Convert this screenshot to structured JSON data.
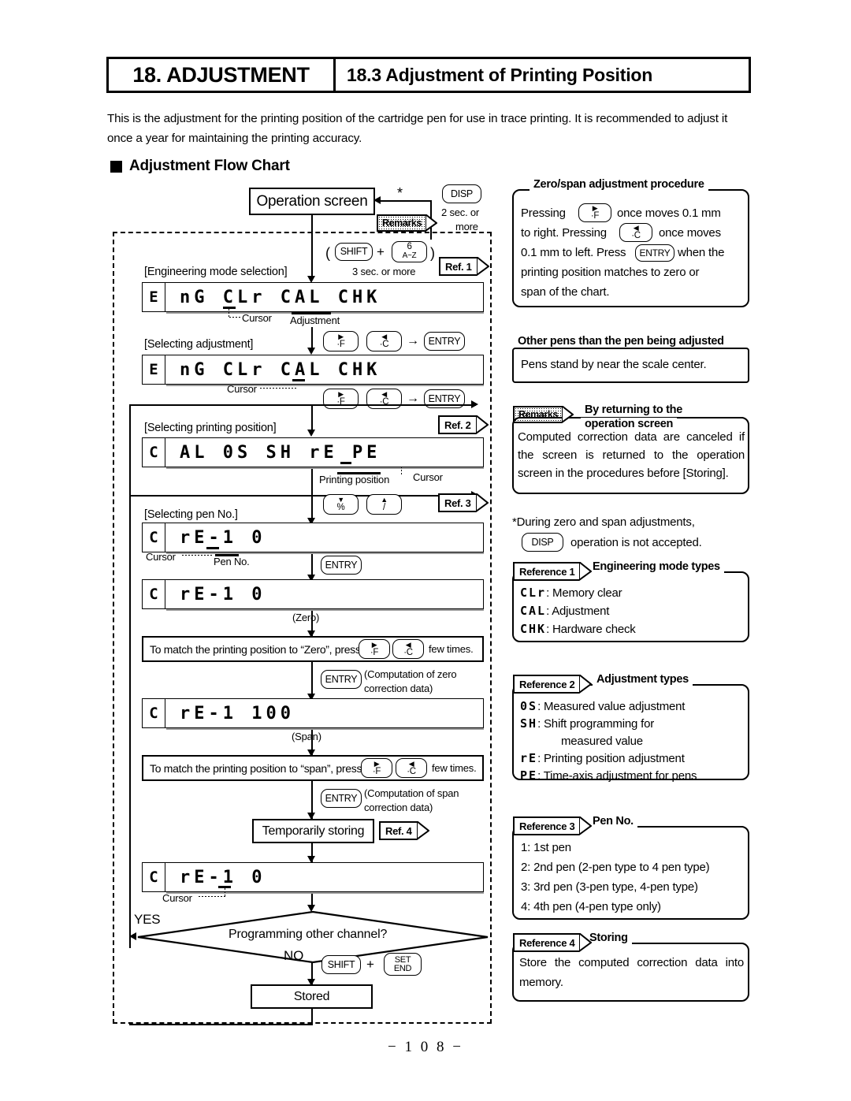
{
  "header": {
    "chapter": "18. ADJUSTMENT",
    "section": "18.3 Adjustment of Printing Position"
  },
  "intro": "This is the adjustment for the printing position of the cartridge pen for use in trace printing. It is recommended to adjust it once a year for maintaining the printing accuracy.",
  "section_title": "Adjustment Flow Chart",
  "flow": {
    "operation_screen": "Operation screen",
    "asterisk": "*",
    "disp_key": "DISP",
    "disp_note_1": "2 sec. or",
    "disp_note_2": "more",
    "remarks_badge": "Remarks",
    "shift_key": "SHIFT",
    "plus": "+",
    "key6_top": "6",
    "key6_sub": "A~Z",
    "paren_open": "(",
    "paren_close": ")",
    "three_sec": "3 sec. or more",
    "ref1": "Ref. 1",
    "ref2": "Ref. 2",
    "ref3": "Ref. 3",
    "ref4": "Ref. 4",
    "label_eng_mode": "[Engineering mode selection]",
    "label_selecting_adj": "[Selecting adjustment]",
    "label_selecting_pos": "[Selecting printing position]",
    "label_selecting_pen": "[Selecting pen No.]",
    "lcd_1_ind": "E",
    "lcd_1_text": "nG  CLr  CAL  CHK",
    "lcd_2_ind": "E",
    "lcd_2_text": "nG  CLr  CAL  CHK",
    "lcd_3_ind": "C",
    "lcd_3_text": "AL   0S  SH  rE  PE",
    "lcd_4_ind": "C",
    "lcd_4_text": "rE-1      0",
    "lcd_5_ind": "C",
    "lcd_5_text": "rE-1      0",
    "lcd_6_ind": "C",
    "lcd_6_text": "rE-1    100",
    "lcd_7_ind": "C",
    "lcd_7_text": "rE-1      0",
    "cursor_label": "Cursor",
    "adjustment_label": "Adjustment",
    "printing_position_label": "Printing position",
    "pen_no_label": "Pen No.",
    "entry_key": "ENTRY",
    "arrow_key_f_sub": "·F",
    "arrow_key_c_sub": "·C",
    "pct_key_sub": "%",
    "slash_key_sub": "/",
    "arrow_to": "→",
    "zero_label": "(Zero)",
    "span_label": "(Span)",
    "zero_instruction": "To match the printing position to “Zero”, press",
    "span_instruction": "To match the printing position to “span”, press",
    "few_times": "few times.",
    "comp_zero_1": "(Computation of zero",
    "comp_zero_2": "correction data)",
    "comp_span_1": "(Computation of span",
    "comp_span_2": "correction data)",
    "temporarily_storing": "Temporarily storing",
    "decision": "Programming other channel?",
    "yes": "YES",
    "no": "NO",
    "set_end_1": "SET",
    "set_end_2": "END",
    "stored": "Stored"
  },
  "panels": {
    "zero_span": {
      "title": "Zero/span adjustment procedure",
      "line1_a": "Pressing",
      "line1_b": "once moves 0.1 mm",
      "line2_a": "to right. Pressing",
      "line2_b": "once moves",
      "line3_a": "0.1 mm to left. Press",
      "line3_b": "when the",
      "line4": "printing position matches to zero or",
      "line5": "span of the chart.",
      "key_f_sub": "·F",
      "key_c_sub": "·C",
      "entry": "ENTRY"
    },
    "other_pens": {
      "title": "Other pens than the pen being adjusted",
      "text": "Pens stand by near the scale center."
    },
    "returning": {
      "badge": "Remarks",
      "title_1": "By returning to the",
      "title_2": "operation screen",
      "body": "Computed correction data are canceled if the screen is returned to the operation screen in the procedures before [Storing]."
    },
    "disp_note": {
      "line1": "*During zero and span adjustments,",
      "key": "DISP",
      "line2": "operation is not accepted."
    },
    "ref1": {
      "tag": "Reference 1",
      "title": "Engineering mode types",
      "items": [
        {
          "code": "CLr",
          "desc": ": Memory clear"
        },
        {
          "code": "CAL",
          "desc": ": Adjustment"
        },
        {
          "code": "CHK",
          "desc": ": Hardware check"
        }
      ]
    },
    "ref2": {
      "tag": "Reference 2",
      "title": "Adjustment types",
      "items": [
        {
          "code": "0S",
          "desc": ":  Measured value adjustment"
        },
        {
          "code": "SH",
          "desc": ":  Shift programming for"
        },
        {
          "code": "",
          "desc": "measured value"
        },
        {
          "code": "rE",
          "desc": ":  Printing position adjustment"
        },
        {
          "code": "PE",
          "desc": ": Time-axis adjustment for pens"
        }
      ]
    },
    "ref3": {
      "tag": "Reference 3",
      "title": "Pen No.",
      "items": [
        "1: 1st pen",
        "2: 2nd pen (2-pen type to 4 pen type)",
        "3: 3rd pen (3-pen type, 4-pen type)",
        "4: 4th pen (4-pen type only)"
      ]
    },
    "ref4": {
      "tag": "Reference 4",
      "title": "Storing",
      "body": "Store the computed correction data into memory."
    }
  },
  "page_number": "− 1 0 8 −"
}
